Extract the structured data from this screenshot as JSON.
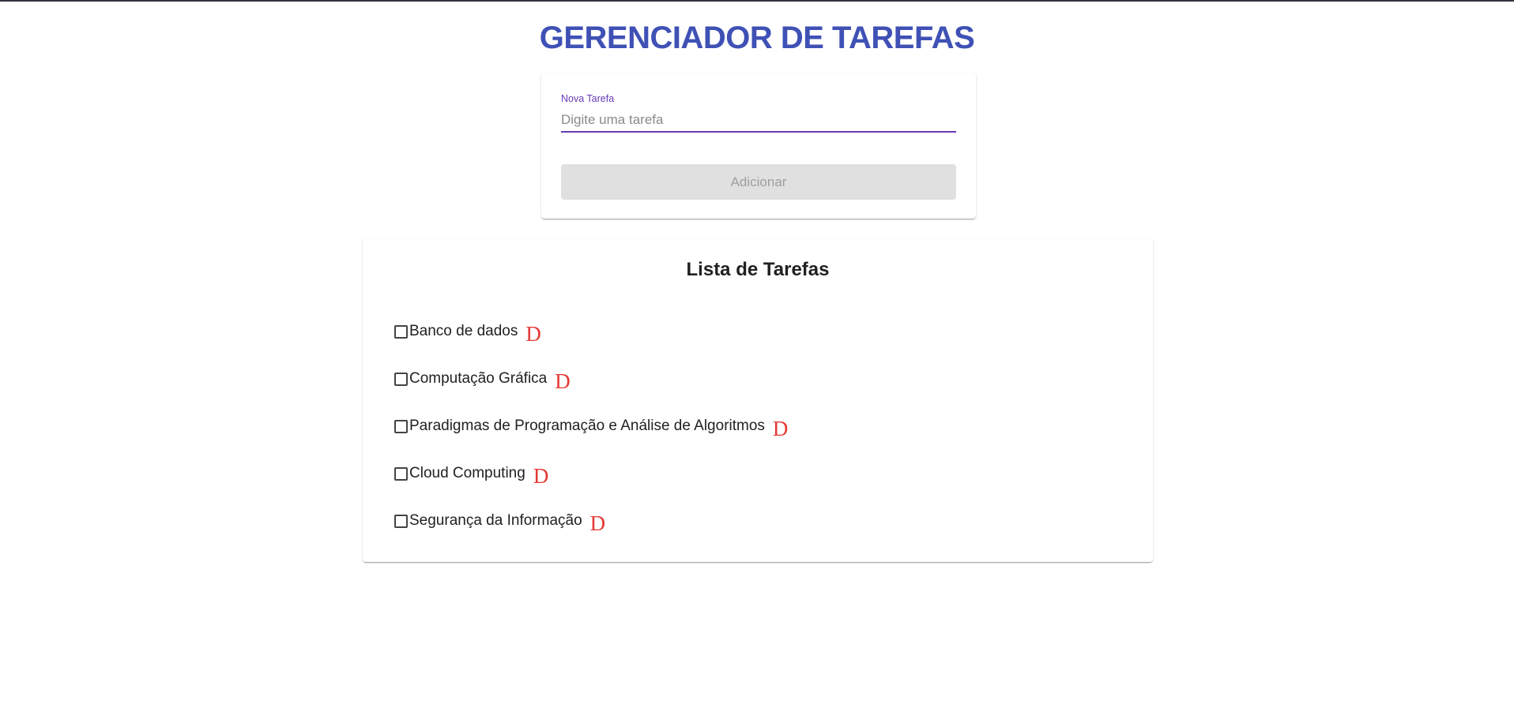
{
  "header": {
    "title": "GERENCIADOR DE TAREFAS"
  },
  "form": {
    "label": "Nova Tarefa",
    "placeholder": "Digite uma tarefa",
    "value": "",
    "button_label": "Adicionar",
    "button_disabled": true
  },
  "list": {
    "title": "Lista de Tarefas",
    "delete_glyph": "D",
    "items": [
      {
        "label": "Banco de dados",
        "checked": false
      },
      {
        "label": "Computação Gráfica",
        "checked": false
      },
      {
        "label": "Paradigmas de Programação e Análise de Algoritmos",
        "checked": false
      },
      {
        "label": "Cloud Computing",
        "checked": false
      },
      {
        "label": "Segurança da Informação",
        "checked": false
      }
    ]
  },
  "colors": {
    "title": "#3f51b5",
    "accent": "#673ab7",
    "delete": "#e53935",
    "button_disabled_bg": "#e0e0e0"
  }
}
